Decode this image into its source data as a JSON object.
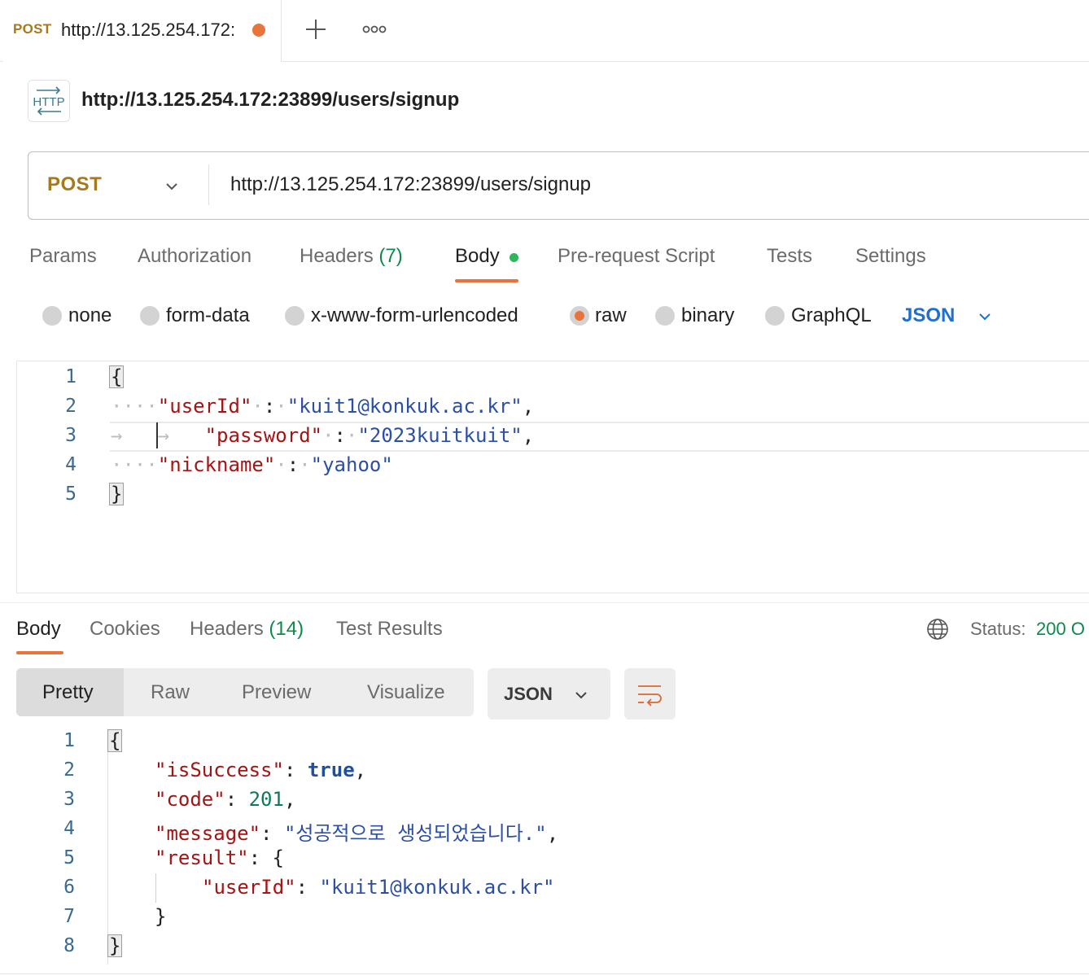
{
  "tab": {
    "method": "POST",
    "title": "http://13.125.254.172:"
  },
  "request": {
    "title": "http://13.125.254.172:23899/users/signup",
    "method": "POST",
    "url": "http://13.125.254.172:23899/users/signup",
    "http_icon": "http-icon"
  },
  "request_tabs": {
    "params": "Params",
    "authorization": "Authorization",
    "headers": "Headers",
    "headers_count": "(7)",
    "body": "Body",
    "pre_request": "Pre-request Script",
    "tests": "Tests",
    "settings": "Settings"
  },
  "body_types": {
    "none": "none",
    "form_data": "form-data",
    "urlencoded": "x-www-form-urlencoded",
    "raw": "raw",
    "binary": "binary",
    "graphql": "GraphQL",
    "selected": "raw",
    "language": "JSON"
  },
  "request_body": {
    "line_numbers": [
      "1",
      "2",
      "3",
      "4",
      "5"
    ],
    "open_brace": "{",
    "close_brace": "}",
    "key_userid": "\"userId\"",
    "val_userid": "\"kuit1@konkuk.ac.kr\"",
    "key_password": "\"password\"",
    "val_password": "\"2023kuitkuit\"",
    "key_nickname": "\"nickname\"",
    "val_nickname": "\"yahoo\""
  },
  "response_tabs": {
    "body": "Body",
    "cookies": "Cookies",
    "headers": "Headers",
    "headers_count": "(14)",
    "test_results": "Test Results",
    "status_label": "Status:",
    "status_value": "200 O"
  },
  "response_view": {
    "pretty": "Pretty",
    "raw": "Raw",
    "preview": "Preview",
    "visualize": "Visualize",
    "format": "JSON"
  },
  "response_body": {
    "line_numbers": [
      "1",
      "2",
      "3",
      "4",
      "5",
      "6",
      "7",
      "8"
    ],
    "open_brace": "{",
    "close_brace": "}",
    "key_issuccess": "\"isSuccess\"",
    "val_issuccess": "true",
    "key_code": "\"code\"",
    "val_code": "201",
    "key_message": "\"message\"",
    "val_message": "\"성공적으로 생성되었습니다.\"",
    "key_result": "\"result\"",
    "key_userid": "\"userId\"",
    "val_userid": "\"kuit1@konkuk.ac.kr\""
  },
  "colors": {
    "accent": "#e8743b",
    "method": "#a6791a",
    "status_ok": "#0b8a4a",
    "link_blue": "#1f6fd1"
  }
}
